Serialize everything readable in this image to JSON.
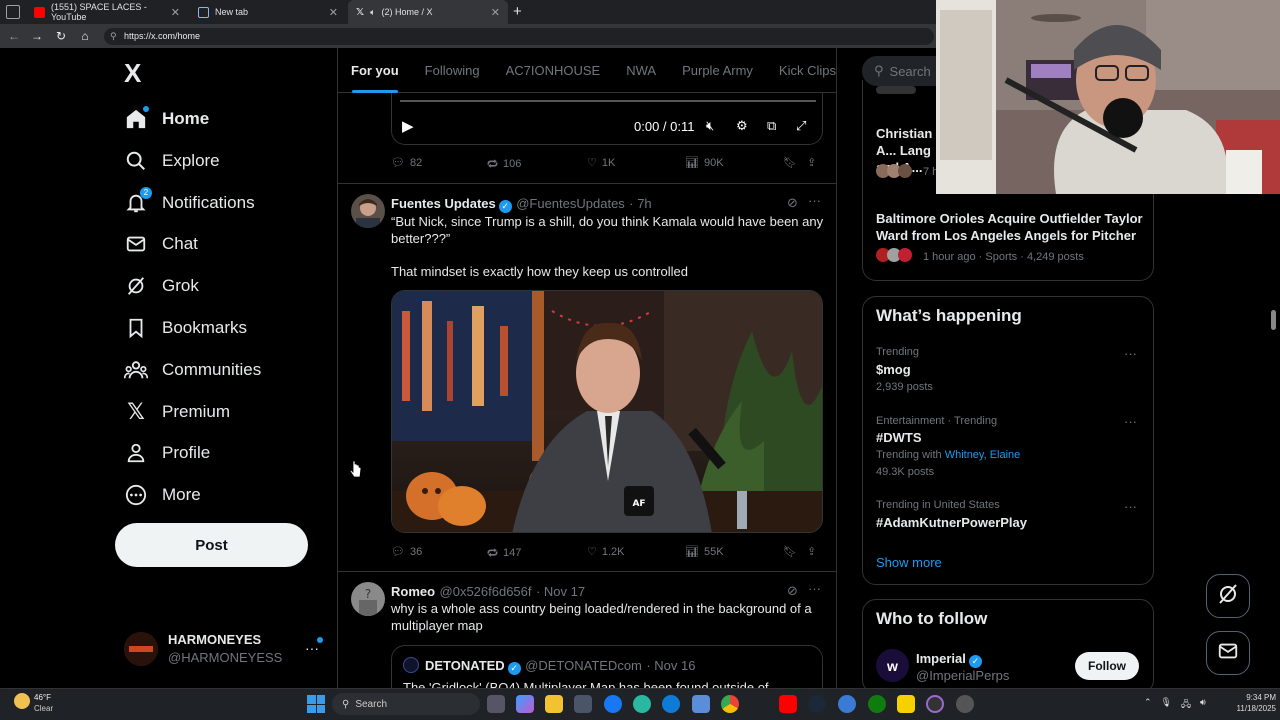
{
  "browser": {
    "tabs": [
      {
        "title": "(1551) SPACE LACES - YouTube",
        "favicon_color": "#ff0000"
      },
      {
        "title": "New tab",
        "favicon_color": "#8ab4f8"
      },
      {
        "title": "(2) Home / X",
        "favicon_color": "#e7e9ea"
      }
    ],
    "new_tab_label": "+",
    "url": "https://x.com/home"
  },
  "nav": {
    "logo": "X",
    "items": [
      {
        "label": "Home",
        "icon": "home-icon"
      },
      {
        "label": "Explore",
        "icon": "search-icon"
      },
      {
        "label": "Notifications",
        "icon": "bell-icon",
        "badge": "2"
      },
      {
        "label": "Chat",
        "icon": "mail-icon"
      },
      {
        "label": "Grok",
        "icon": "grok-icon"
      },
      {
        "label": "Bookmarks",
        "icon": "bookmark-icon"
      },
      {
        "label": "Communities",
        "icon": "communities-icon"
      },
      {
        "label": "Premium",
        "icon": "x-premium-icon"
      },
      {
        "label": "Profile",
        "icon": "person-icon"
      },
      {
        "label": "More",
        "icon": "more-circle-icon"
      }
    ],
    "post_label": "Post",
    "account": {
      "name": "HARMONEYES",
      "handle": "@HARMONEYESS",
      "more": "···"
    }
  },
  "feed": {
    "tabs": [
      "For you",
      "Following",
      "AC7IONHOUSE",
      "NWA",
      "Purple Army",
      "Kick Clips"
    ],
    "video_time": "0:00 / 0:11",
    "tweet0_actions": {
      "replies": "82",
      "reposts": "106",
      "likes": "1K",
      "views": "90K"
    },
    "tweet1": {
      "name": "Fuentes Updates",
      "handle": "@FuentesUpdates",
      "time": "· 7h",
      "text1": "“But Nick, since Trump is a shill, do you think Kamala would have been any better???”",
      "text2": "That mindset is exactly how they keep us controlled",
      "actions": {
        "replies": "36",
        "reposts": "147",
        "likes": "1.2K",
        "views": "55K"
      }
    },
    "tweet2": {
      "name": "Romeo",
      "handle": "@0x526f6d656f",
      "time": "· Nov 17",
      "text": "why is a whole ass country being loaded/rendered in the background of a multiplayer map",
      "quote": {
        "name": "DETONATED",
        "handle": "@DETONATEDcom",
        "time": "· Nov 16",
        "text": "The 'Gridlock' (BO4) Multiplayer Map has been found outside of"
      }
    }
  },
  "sidebar": {
    "search_placeholder": "Search",
    "top_news": [
      {
        "title": "Christian A... Lang and A...",
        "meta": "7 h"
      },
      {
        "title": "Baltimore Orioles Acquire Outfielder Taylor Ward from Los Angeles Angels for Pitcher ...",
        "meta": "1 hour ago · Sports · 4,249 posts"
      }
    ],
    "happening_title": "What’s happening",
    "trends": [
      {
        "context": "Trending",
        "name": "$mog",
        "posts": "2,939 posts"
      },
      {
        "context": "Entertainment · Trending",
        "name": "#DWTS",
        "with_label": "Trending with",
        "with": "Whitney, Elaine",
        "posts": "49.3K posts"
      },
      {
        "context": "Trending in United States",
        "name": "#AdamKutnerPowerPlay"
      }
    ],
    "show_more": "Show more",
    "who_to_follow_title": "Who to follow",
    "follow_suggestion": {
      "name": "Imperial",
      "handle": "@ImperialPerps",
      "button": "Follow"
    }
  },
  "taskbar": {
    "weather_temp": "46°F",
    "weather_desc": "Clear",
    "search_label": "Search",
    "time": "9:34 PM",
    "date": "11/18/2025"
  }
}
